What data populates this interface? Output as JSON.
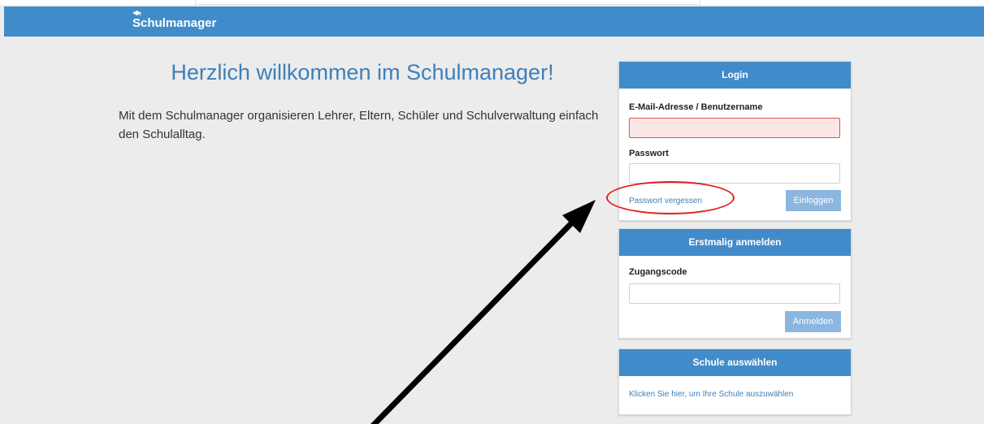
{
  "header": {
    "brand": "Schulmanager"
  },
  "intro": {
    "title": "Herzlich willkommen im Schulmanager!",
    "text": "Mit dem Schulmanager organisieren Lehrer, Eltern, Schüler und Schulverwaltung einfach den Schulalltag."
  },
  "login": {
    "heading": "Login",
    "email_label": "E-Mail-Adresse / Benutzername",
    "password_label": "Passwort",
    "forgot_link": "Passwort vergessen",
    "submit_label": "Einloggen"
  },
  "register": {
    "heading": "Erstmalig anmelden",
    "code_label": "Zugangscode",
    "submit_label": "Anmelden"
  },
  "school": {
    "heading": "Schule auswählen",
    "link": "Klicken Sie hier, um Ihre Schule auszuwählen"
  },
  "colors": {
    "navbar": "#428bca",
    "title": "#3f7fb9",
    "button": "#8bb6e0",
    "highlight": "#e02020"
  }
}
